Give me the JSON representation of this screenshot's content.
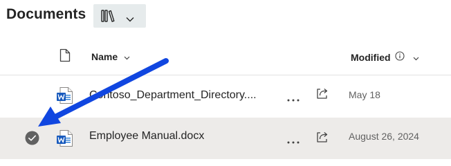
{
  "header": {
    "title": "Documents",
    "view_switcher_icon": "library-view-icon"
  },
  "columns": {
    "file_type_icon": "document-icon",
    "name": "Name",
    "modified": "Modified"
  },
  "files": [
    {
      "name": "Contoso_Department_Directory....",
      "type_icon": "word-document-icon",
      "modified": "May 18",
      "selected": false
    },
    {
      "name": "Employee Manual.docx",
      "type_icon": "word-document-icon",
      "modified": "August 26, 2024",
      "selected": true
    }
  ],
  "annotation": {
    "arrow_color": "#1046e0"
  },
  "colors": {
    "selected_row_bg": "#edebe9",
    "word_blue": "#185abd",
    "text": "#242424",
    "muted_text": "#616161"
  }
}
